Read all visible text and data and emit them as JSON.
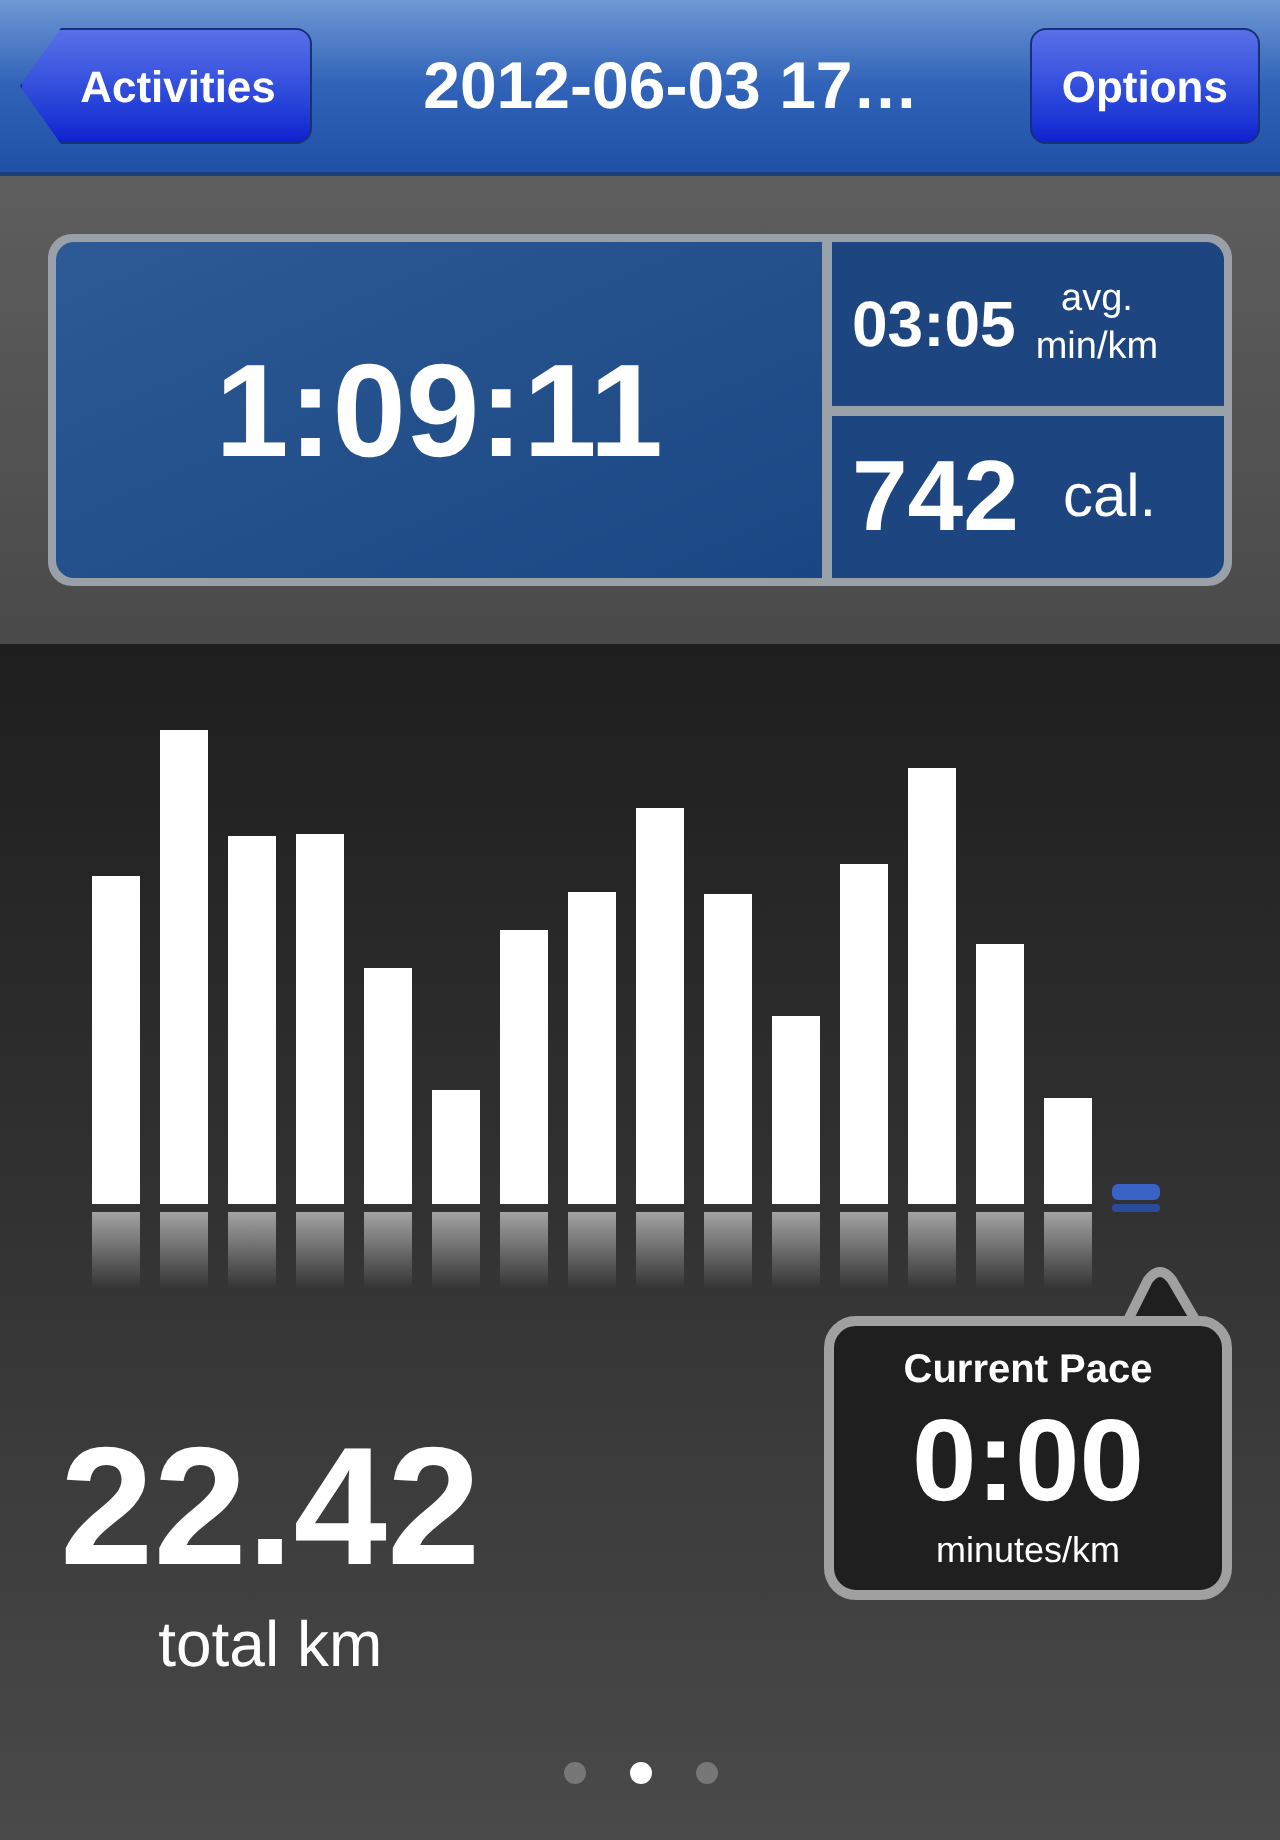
{
  "nav_bar": {
    "back_button": "Activities",
    "title": "2012-06-03 17…",
    "options_button": "Options"
  },
  "stats": {
    "duration": "1:09:11",
    "pace": {
      "value": "03:05",
      "unit_line_1": "avg.",
      "unit_line_2": "min/km"
    },
    "calories": {
      "value": "742",
      "unit": "cal."
    }
  },
  "distance": {
    "value": "22.42",
    "unit": "total km"
  },
  "current_pace": {
    "label": "Current Pace",
    "value": "0:00",
    "unit": "minutes/km"
  },
  "pages": [
    {
      "selected": false
    },
    {
      "selected": true
    },
    {
      "selected": false
    }
  ]
}
